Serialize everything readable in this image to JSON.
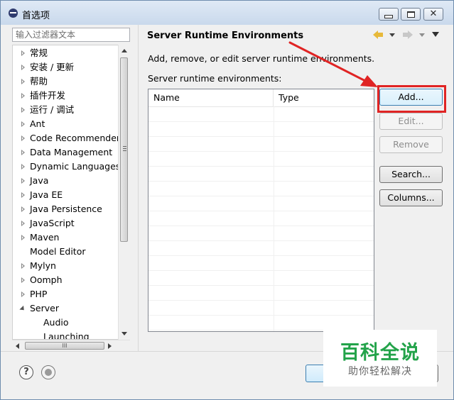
{
  "window": {
    "title": "首选项"
  },
  "filter": {
    "placeholder": "输入过滤器文本"
  },
  "tree": {
    "items": [
      {
        "label": "常规",
        "state": "closed"
      },
      {
        "label": "安装 / 更新",
        "state": "closed"
      },
      {
        "label": "帮助",
        "state": "closed"
      },
      {
        "label": "插件开发",
        "state": "closed"
      },
      {
        "label": "运行 / 调试",
        "state": "closed"
      },
      {
        "label": "Ant",
        "state": "closed"
      },
      {
        "label": "Code Recommenders",
        "state": "closed"
      },
      {
        "label": "Data Management",
        "state": "closed"
      },
      {
        "label": "Dynamic Languages",
        "state": "closed"
      },
      {
        "label": "Java",
        "state": "closed"
      },
      {
        "label": "Java EE",
        "state": "closed"
      },
      {
        "label": "Java Persistence",
        "state": "closed"
      },
      {
        "label": "JavaScript",
        "state": "closed"
      },
      {
        "label": "Maven",
        "state": "closed"
      },
      {
        "label": "Model Editor",
        "state": "none"
      },
      {
        "label": "Mylyn",
        "state": "closed"
      },
      {
        "label": "Oomph",
        "state": "closed"
      },
      {
        "label": "PHP",
        "state": "closed"
      },
      {
        "label": "Server",
        "state": "open"
      },
      {
        "label": "Audio",
        "state": "child"
      },
      {
        "label": "Launching",
        "state": "child"
      }
    ],
    "scroll_grip": "III"
  },
  "page": {
    "title": "Server Runtime Environments",
    "description": "Add, remove, or edit server runtime environments.",
    "list_label": "Server runtime environments:",
    "columns": {
      "name": "Name",
      "type": "Type"
    }
  },
  "buttons": {
    "add": "Add...",
    "edit": "Edit...",
    "remove": "Remove",
    "search": "Search...",
    "columns": "Columns..."
  },
  "footer": {
    "help_glyph": "?"
  },
  "watermark": {
    "title": "百科全说",
    "subtitle": "助你轻松解决"
  },
  "colors": {
    "highlight": "#e02424",
    "watermark": "#23a34a"
  }
}
